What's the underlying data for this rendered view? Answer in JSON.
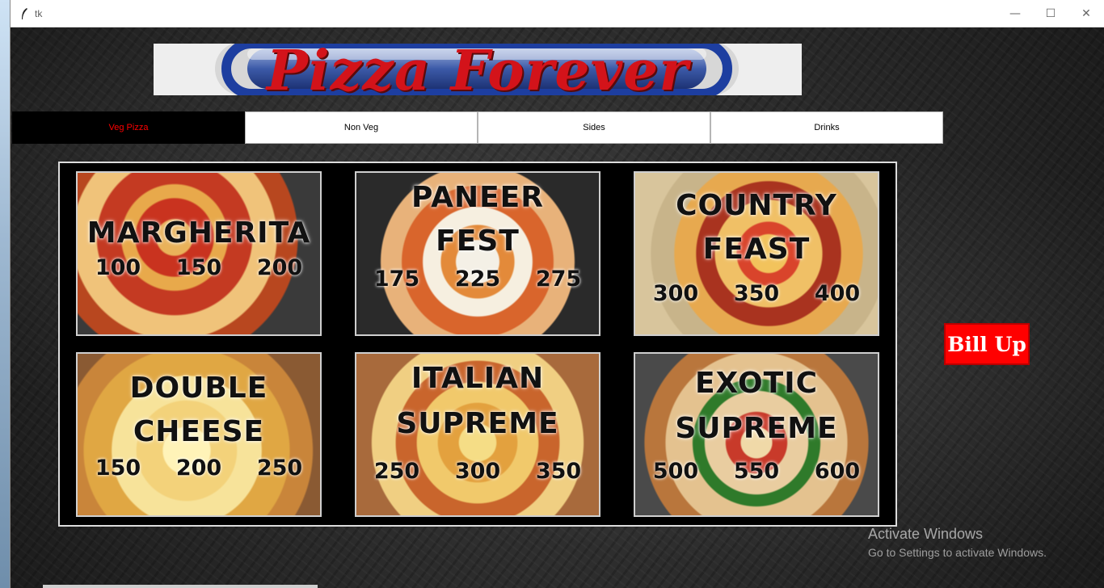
{
  "window": {
    "title": "tk",
    "min": "—",
    "max": "☐",
    "close": "✕"
  },
  "banner": {
    "text": "Pizza Forever"
  },
  "tabs": [
    {
      "label": "Veg Pizza",
      "active": true
    },
    {
      "label": "Non Veg",
      "active": false
    },
    {
      "label": "Sides",
      "active": false
    },
    {
      "label": "Drinks",
      "active": false
    }
  ],
  "pizzas": [
    {
      "name_lines": [
        "MARGHERITA"
      ],
      "prices": [
        "100",
        "150",
        "200"
      ]
    },
    {
      "name_lines": [
        "PANEER",
        "FEST"
      ],
      "prices": [
        "175",
        "225",
        "275"
      ]
    },
    {
      "name_lines": [
        "COUNTRY",
        "FEAST"
      ],
      "prices": [
        "300",
        "350",
        "400"
      ]
    },
    {
      "name_lines": [
        "DOUBLE",
        "CHEESE"
      ],
      "prices": [
        "150",
        "200",
        "250"
      ]
    },
    {
      "name_lines": [
        "ITALIAN",
        "SUPREME"
      ],
      "prices": [
        "250",
        "300",
        "350"
      ]
    },
    {
      "name_lines": [
        "EXOTIC",
        "SUPREME"
      ],
      "prices": [
        "500",
        "550",
        "600"
      ]
    }
  ],
  "bill_button": {
    "label": "Bill Up"
  },
  "watermark": {
    "title": "Activate Windows",
    "subtitle": "Go to Settings to activate Windows."
  },
  "colors": {
    "accent": "#ff0000",
    "tab_active_bg": "#000000",
    "tab_active_text": "#ff0000"
  }
}
